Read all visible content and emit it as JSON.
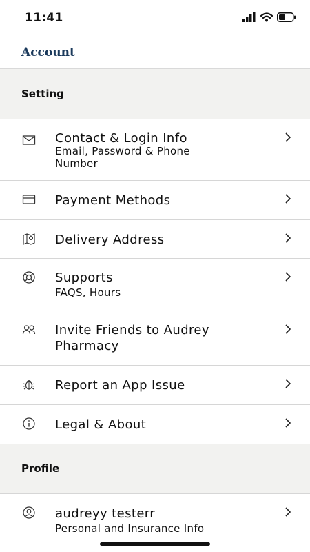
{
  "status": {
    "time": "11:41"
  },
  "header": {
    "title": "Account"
  },
  "sections": {
    "setting": "Setting",
    "profile": "Profile"
  },
  "rows": {
    "contact": {
      "title": "Contact & Login Info",
      "subtitle_line1": "Email, Password & Phone",
      "subtitle_line2": "Number",
      "icon": "envelope-icon"
    },
    "payment": {
      "title": "Payment Methods",
      "icon": "credit-card-icon"
    },
    "delivery": {
      "title": "Delivery Address",
      "icon": "map-pin-icon"
    },
    "supports": {
      "title": "Supports",
      "subtitle": "FAQS, Hours",
      "icon": "lifebuoy-icon"
    },
    "invite": {
      "title_line1": "Invite Friends to Audrey",
      "title_line2": "Pharmacy",
      "icon": "users-icon"
    },
    "report": {
      "title": "Report an App Issue",
      "icon": "bug-icon"
    },
    "legal": {
      "title": "Legal & About",
      "icon": "info-icon"
    },
    "profile": {
      "title": "audreyy testerr",
      "subtitle": "Personal and Insurance Info",
      "icon": "user-circle-icon"
    }
  }
}
